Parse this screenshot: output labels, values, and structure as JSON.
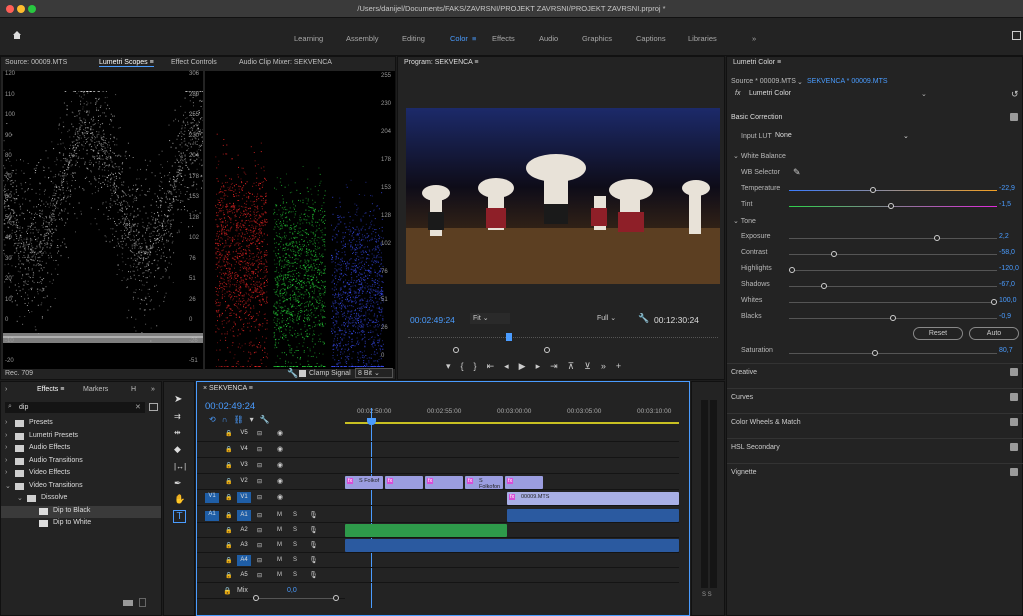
{
  "window": {
    "title": "/Users/danijel/Documents/FAKS/ZAVRSNI/PROJEKT ZAVRSNI/PROJEKT ZAVRSNI.prproj *"
  },
  "workspaces": [
    "Learning",
    "Assembly",
    "Editing",
    "Color",
    "Effects",
    "Audio",
    "Graphics",
    "Captions",
    "Libraries"
  ],
  "workspace_more": "»",
  "source_panel": {
    "tabs": [
      "Source: 00009.MTS",
      "Lumetri Scopes",
      "Effect Controls",
      "Audio Clip Mixer: SEKVENCA"
    ],
    "luma_scale": [
      "120",
      "110",
      "100",
      "90",
      "80",
      "70",
      "60",
      "50",
      "40",
      "30",
      "20",
      "10",
      "0",
      "-10",
      "-20"
    ],
    "luma_scale_b": [
      "306",
      "280",
      "255",
      "230",
      "204",
      "178",
      "153",
      "128",
      "102",
      "76",
      "51",
      "26",
      "0",
      "-26",
      "-51"
    ],
    "parade_scale": [
      "255",
      "230",
      "204",
      "178",
      "153",
      "128",
      "102",
      "76",
      "51",
      "26",
      "0"
    ],
    "footer_left": "Rec. 709",
    "clamp_label": "Clamp Signal",
    "bit_depth": "8 Bit"
  },
  "program": {
    "title": "Program: SEKVENCA",
    "timecode": "00:02:49:24",
    "fit": "Fit",
    "quality": "Full",
    "duration": "00:12:30:24"
  },
  "lumetri": {
    "title": "Lumetri Color",
    "source_label": "Source * 00009.MTS",
    "sequence_label": "SEKVENCA * 00009.MTS",
    "fx_label": "Lumetri Color",
    "basic_correction": "Basic Correction",
    "input_lut_label": "Input LUT",
    "input_lut_value": "None",
    "white_balance": "White Balance",
    "wb_selector": "WB Selector",
    "tone": "Tone",
    "sliders": [
      {
        "label": "Temperature",
        "value": "-22,9",
        "pos": 0.4
      },
      {
        "label": "Tint",
        "value": "-1,5",
        "pos": 0.49
      },
      {
        "label": "Exposure",
        "value": "2,2",
        "pos": 0.72
      },
      {
        "label": "Contrast",
        "value": "-58,0",
        "pos": 0.21
      },
      {
        "label": "Highlights",
        "value": "-120,0",
        "pos": 0.0
      },
      {
        "label": "Shadows",
        "value": "-67,0",
        "pos": 0.16
      },
      {
        "label": "Whites",
        "value": "100,0",
        "pos": 1.0
      },
      {
        "label": "Blacks",
        "value": "-0,9",
        "pos": 0.5
      }
    ],
    "reset": "Reset",
    "auto": "Auto",
    "saturation_label": "Saturation",
    "saturation_value": "80,7",
    "saturation_pos": 0.41,
    "sections": [
      "Creative",
      "Curves",
      "Color Wheels & Match",
      "HSL Secondary",
      "Vignette"
    ]
  },
  "effects_panel": {
    "tabs": [
      "Effects",
      "Markers",
      "H"
    ],
    "search_value": "dip",
    "tree": [
      {
        "label": "Presets",
        "level": 0,
        "open": false
      },
      {
        "label": "Lumetri Presets",
        "level": 0,
        "open": false
      },
      {
        "label": "Audio Effects",
        "level": 0,
        "open": false
      },
      {
        "label": "Audio Transitions",
        "level": 0,
        "open": false
      },
      {
        "label": "Video Effects",
        "level": 0,
        "open": false
      },
      {
        "label": "Video Transitions",
        "level": 0,
        "open": true
      },
      {
        "label": "Dissolve",
        "level": 1,
        "open": true
      },
      {
        "label": "Dip to Black",
        "level": 2,
        "selected": true
      },
      {
        "label": "Dip to White",
        "level": 2
      }
    ]
  },
  "timeline": {
    "tab": "SEKVENCA",
    "timecode": "00:02:49:24",
    "ruler": [
      "00:02:50:00",
      "00:02:55:00",
      "00:03:00:00",
      "00:03:05:00",
      "00:03:10:00"
    ],
    "video_tracks": [
      "V5",
      "V4",
      "V3",
      "V2",
      "V1"
    ],
    "audio_tracks": [
      "A1",
      "A2",
      "A3",
      "A4",
      "A5"
    ],
    "mix_label": "Mix",
    "mix_value": "0,0",
    "v2_clips": [
      "S Folkof",
      "S Folkofon"
    ],
    "v1_clip": "00009.MTS",
    "meter_label": "S S"
  }
}
